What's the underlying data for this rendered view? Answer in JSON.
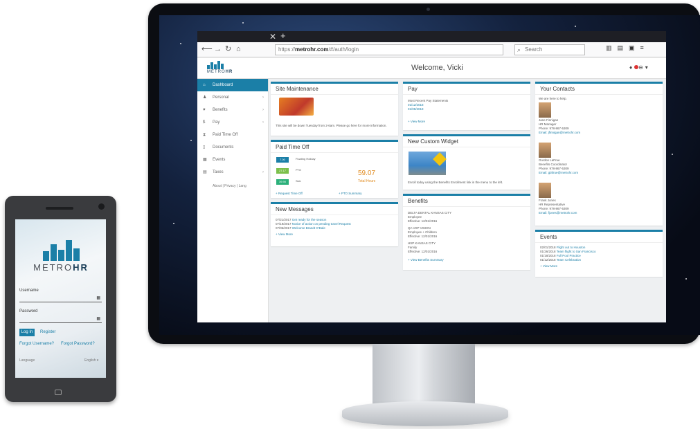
{
  "browser": {
    "url_prefix": "https://",
    "url_domain": "metrohr.com",
    "url_path": "/#/auth/login",
    "search_placeholder": "Search"
  },
  "app": {
    "logo_word_a": "METRO",
    "logo_word_b": "HR",
    "welcome": "Welcome, Vicki"
  },
  "sidebar": {
    "items": [
      {
        "label": "Dashboard",
        "icon": "home-icon"
      },
      {
        "label": "Personal",
        "icon": "person-icon"
      },
      {
        "label": "Benefits",
        "icon": "benefits-icon"
      },
      {
        "label": "Pay",
        "icon": "dollar-icon"
      },
      {
        "label": "Paid Time Off",
        "icon": "hourglass-icon"
      },
      {
        "label": "Documents",
        "icon": "document-icon"
      },
      {
        "label": "Events",
        "icon": "calendar-icon"
      },
      {
        "label": "Taxes",
        "icon": "taxes-icon"
      }
    ],
    "footer": "About | Privacy | Lang"
  },
  "cards": {
    "maintenance": {
      "title": "Site Maintenance",
      "text": "This site will be down Tuesday from 2-6am. Please go here for more information."
    },
    "pto": {
      "title": "Paid Time Off",
      "rows": [
        {
          "value": "7.00",
          "label": "Floating Holiday"
        },
        {
          "value": "27.17",
          "label": "PTO"
        },
        {
          "value": "39.90",
          "label": "Sick"
        }
      ],
      "total": "59.07",
      "total_label": "Total Hours",
      "request_link": "+ Request Time Off",
      "summary_link": "+ PTO Summary"
    },
    "messages": {
      "title": "New Messages",
      "items": [
        {
          "date": "07/21/2017",
          "text": "Get ready for the season"
        },
        {
          "date": "07/19/2017",
          "text": "Notice of action on pending travel Request"
        },
        {
          "date": "07/06/2017",
          "text": "Welcome Brandt O'Dale"
        }
      ],
      "more": "+ View More"
    },
    "pay": {
      "title": "Pay",
      "subtitle": "Most Recent Pay Statements",
      "dates": [
        "01/12/2018",
        "01/05/2018"
      ],
      "more": "+ View More"
    },
    "widget": {
      "title": "New Custom Widget",
      "text": "Enroll today using the Benefits Enrollment link in the menu to the left."
    },
    "benefits": {
      "title": "Benefits",
      "items": [
        {
          "plan": "DELTA DENTAL KANSAS CITY",
          "coverage": "Employee",
          "effective": "Effective: 12/01/2016"
        },
        {
          "plan": "QA VSP VISION",
          "coverage": "Employee + Children",
          "effective": "Effective: 12/01/2016"
        },
        {
          "plan": "HSP KANSAS CITY",
          "coverage": "Family",
          "effective": "Effective: 12/01/2016"
        }
      ],
      "more": "+ View Benefits Summary"
    },
    "contacts": {
      "title": "Your Contacts",
      "intro": "We are here to help.",
      "people": [
        {
          "name": "Jane Finnigan",
          "role": "HR Manager",
          "phone": "Phone: 978-867-5309",
          "email": "Email: jfinnigan@metrohr.com"
        },
        {
          "name": "Gordon LaFrue",
          "role": "Benefits Coordinator",
          "phone": "Phone: 978-867-5309",
          "email": "Email: glafrue@metrohr.com"
        },
        {
          "name": "Frank Jones",
          "role": "HR Representative",
          "phone": "Phone: 978-867-5309",
          "email": "Email: fjones@metrohr.com"
        }
      ]
    },
    "events": {
      "title": "Events",
      "items": [
        {
          "date": "02/01/2018",
          "text": "Flight out to Houston"
        },
        {
          "date": "01/26/2018",
          "text": "Team flight to San Francisco"
        },
        {
          "date": "01/18/2018",
          "text": "Full Pool Practice"
        },
        {
          "date": "01/12/2018",
          "text": "Team Celebration"
        }
      ],
      "more": "+ View More"
    }
  },
  "phone": {
    "logo_word_a": "METRO",
    "logo_word_b": "HR",
    "username_label": "Username",
    "password_label": "Password",
    "login_label": "Log In",
    "register_label": "Register",
    "forgot_username": "Forgot Username?",
    "forgot_password": "Forgot Password?",
    "language_label": "Language",
    "language_value": "English"
  },
  "colors": {
    "accent": "#1b7fa7",
    "orange": "#e08a1e"
  }
}
